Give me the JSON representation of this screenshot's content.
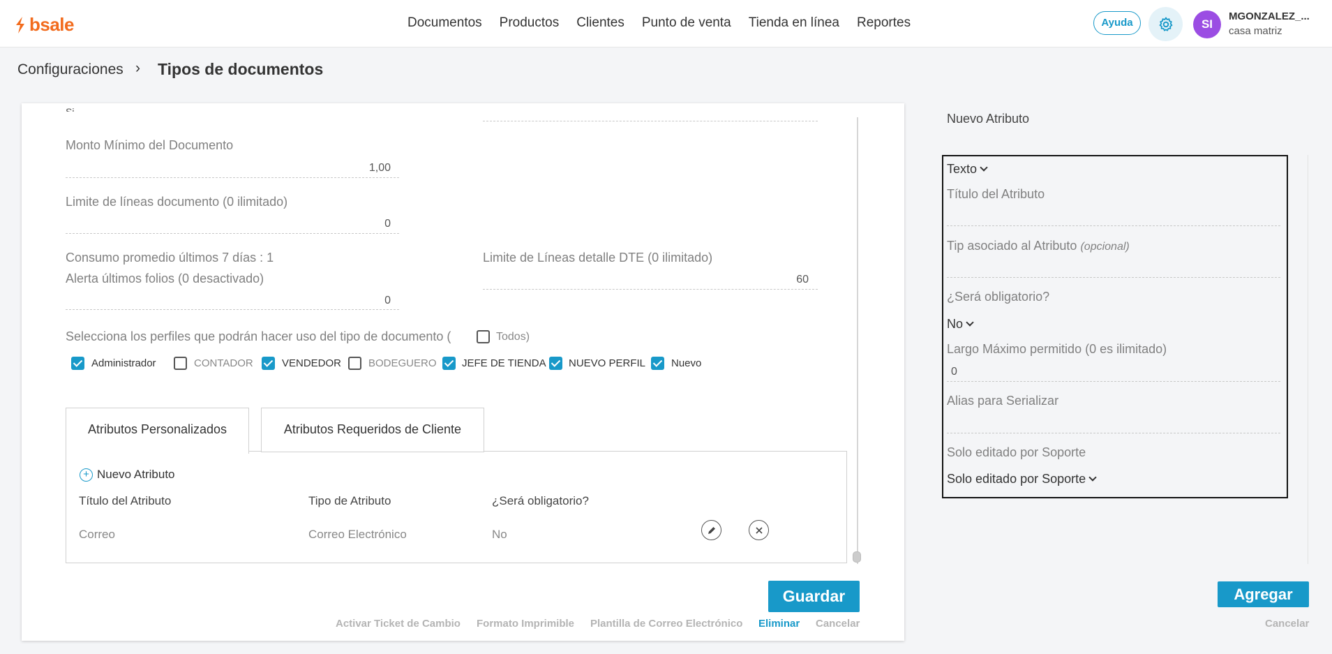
{
  "brand": {
    "name": "bsale",
    "color": "#f26b1d"
  },
  "accent": "#1899c9",
  "nav": {
    "items": [
      "Documentos",
      "Productos",
      "Clientes",
      "Punto de venta",
      "Tienda en línea",
      "Reportes"
    ],
    "help": "Ayuda",
    "settings_icon": "gear-icon",
    "user": {
      "initials": "SI",
      "name": "MGONZALEZ_...",
      "branch": "casa matriz",
      "avatar_color": "#9b4de3"
    }
  },
  "breadcrumb": {
    "root": "Configuraciones",
    "separator": "›",
    "current": "Tipos de documentos"
  },
  "form": {
    "cut_off_top": "Si -",
    "min_amount": {
      "label": "Monto Mínimo del Documento",
      "value": "1,00"
    },
    "line_limit": {
      "label": "Limite de líneas documento (0 ilimitado)",
      "value": "0"
    },
    "avg_consumption": "Consumo promedio últimos 7 días : 1",
    "folio_alert": {
      "label": "Alerta últimos folios (0 desactivado)",
      "value": "0"
    },
    "dte_limit": {
      "label": "Limite de Líneas detalle DTE (0 ilimitado)",
      "value": "60"
    },
    "profiles_prompt": "Selecciona los perfiles que podrán hacer uso del tipo de documento (",
    "profiles_all": {
      "label": "Todos)",
      "checked": false
    },
    "profiles": [
      {
        "label": "Administrador",
        "checked": true
      },
      {
        "label": "CONTADOR",
        "checked": false
      },
      {
        "label": "VENDEDOR",
        "checked": true
      },
      {
        "label": "BODEGUERO",
        "checked": false
      },
      {
        "label": "JEFE DE TIENDA",
        "checked": true
      },
      {
        "label": "NUEVO PERFIL",
        "checked": true
      },
      {
        "label": "Nuevo",
        "checked": true
      }
    ]
  },
  "tabs": [
    {
      "label": "Atributos Personalizados",
      "active": true
    },
    {
      "label": "Atributos Requeridos de Cliente",
      "active": false
    }
  ],
  "attributes": {
    "add_label": "Nuevo Atributo",
    "columns": [
      "Título del Atributo",
      "Tipo de Atributo",
      "¿Será obligatorio?"
    ],
    "rows": [
      {
        "title": "Correo",
        "type": "Correo Electrónico",
        "required": "No",
        "edit_icon": "pencil-icon",
        "delete_icon": "close-icon"
      }
    ]
  },
  "actions": {
    "save": "Guardar",
    "links": [
      "Activar Ticket de Cambio",
      "Formato Imprimible",
      "Plantilla de Correo Electrónico",
      "Eliminar",
      "Cancelar"
    ]
  },
  "new_attribute": {
    "heading": "Nuevo Atributo",
    "type_select": "Texto",
    "title_label": "Título del Atributo",
    "title_value": "",
    "tip_label": "Tip asociado al Atributo",
    "tip_optional": "(opcional)",
    "tip_value": "",
    "required_label": "¿Será obligatorio?",
    "required_select": "No",
    "max_length_label": "Largo Máximo permitido (0 es ilimitado)",
    "max_length_value": "0",
    "alias_label": "Alias para Serializar",
    "alias_value": "",
    "support_label": "Solo editado por Soporte",
    "support_select": "Solo editado por Soporte",
    "add_button": "Agregar",
    "cancel": "Cancelar"
  }
}
